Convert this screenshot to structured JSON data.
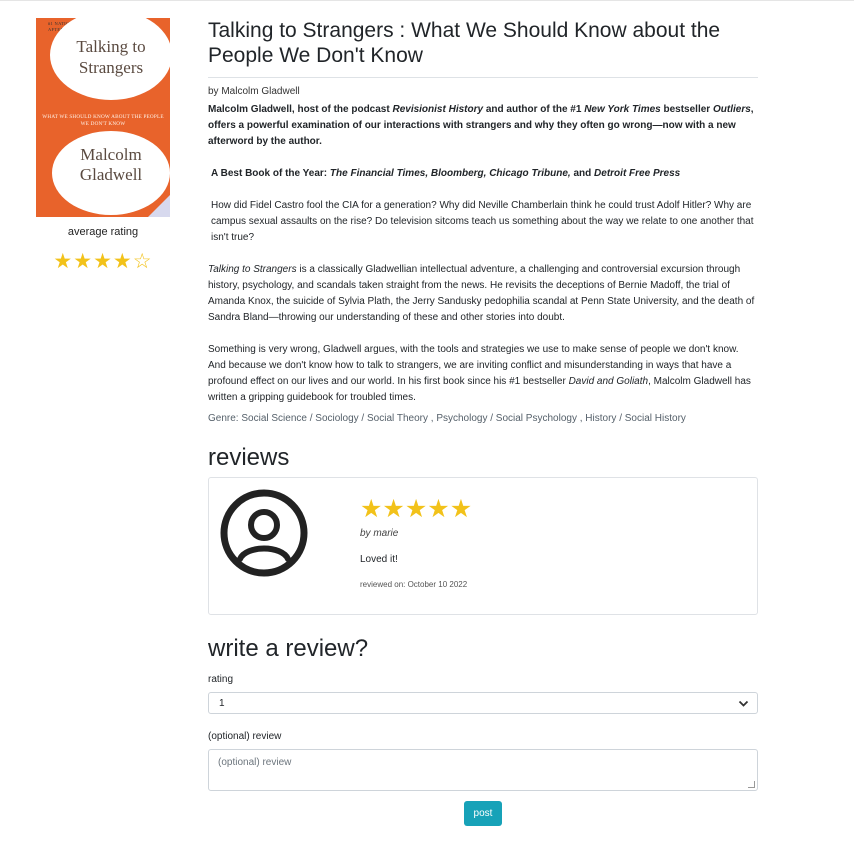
{
  "book": {
    "cover": {
      "top_text": "#1 NATIONAL BESTSELLER · WITH A NEW AFTERWORD BY THE AUTHOR",
      "title_line1": "Talking to",
      "title_line2": "Strangers",
      "subtitle": "WHAT WE SHOULD KNOW ABOUT THE PEOPLE WE DON'T KNOW",
      "author_line1": "Malcolm",
      "author_line2": "Gladwell"
    },
    "average_rating_label": "average rating",
    "average_rating": 4,
    "average_rating_max": 5,
    "title": "Talking to Strangers : What We Should Know about the People We Don't Know",
    "author": "by Malcolm Gladwell",
    "description": {
      "p1_a": "Malcolm Gladwell, host of the podcast ",
      "p1_b": "Revisionist History",
      "p1_c": " and author of the #1 ",
      "p1_d": "New York Times",
      "p1_e": " bestseller ",
      "p1_f": "Outliers",
      "p1_g": ", offers a powerful examination of our interactions with strangers and why they often go wrong—now with a new afterword by the author.",
      "p2_a": "A Best Book of the Year: ",
      "p2_b": "The Financial Times, Bloomberg, Chicago Tribune,",
      "p2_c": " and ",
      "p2_d": "Detroit Free Press",
      "p3": "How did Fidel Castro fool the CIA for a generation? Why did Neville Chamberlain think he could trust Adolf Hitler? Why are campus sexual assaults on the rise? Do television sitcoms teach us something about the way we relate to one another that isn't true?",
      "p4_a": "Talking to Strangers",
      "p4_b": " is a classically Gladwellian intellectual adventure, a challenging and controversial excursion through history, psychology, and scandals taken straight from the news. He revisits the deceptions of Bernie Madoff, the trial of Amanda Knox, the suicide of Sylvia Plath, the Jerry Sandusky pedophilia scandal at Penn State University, and the death of Sandra Bland—throwing our understanding of these and other stories into doubt.",
      "p5_a": "Something is very wrong, Gladwell argues, with the tools and strategies we use to make sense of people we don't know. And because we don't know how to talk to strangers, we are inviting conflict and misunderstanding in ways that have a profound effect on our lives and our world. In his first book since his #1 bestseller ",
      "p5_b": "David and Goliath",
      "p5_c": ", Malcolm Gladwell has written a gripping guidebook for troubled times."
    },
    "genre_prefix": "Genre: ",
    "genres": {
      "g1": "Social Science",
      "s1": " / ",
      "g2": "Sociology",
      "s2": " / ",
      "g3": "Social Theory",
      "s3": " , ",
      "g4": "Psychology",
      "s4": " / ",
      "g5": "Social Psychology",
      "s5": " , ",
      "g6": "History",
      "s6": " / ",
      "g7": "Social History"
    }
  },
  "reviews": {
    "heading": "reviews",
    "items": [
      {
        "rating": 5,
        "by": "by marie",
        "text": "Loved it!",
        "date": "reviewed on: October 10 2022"
      }
    ]
  },
  "write_review": {
    "heading": "write a review?",
    "rating_label": "rating",
    "rating_value": "1",
    "review_label": "(optional) review",
    "review_placeholder": "(optional) review",
    "post_label": "post"
  },
  "colors": {
    "star": "#f2c21a",
    "cover": "#e8632b",
    "button": "#17a2b8"
  }
}
